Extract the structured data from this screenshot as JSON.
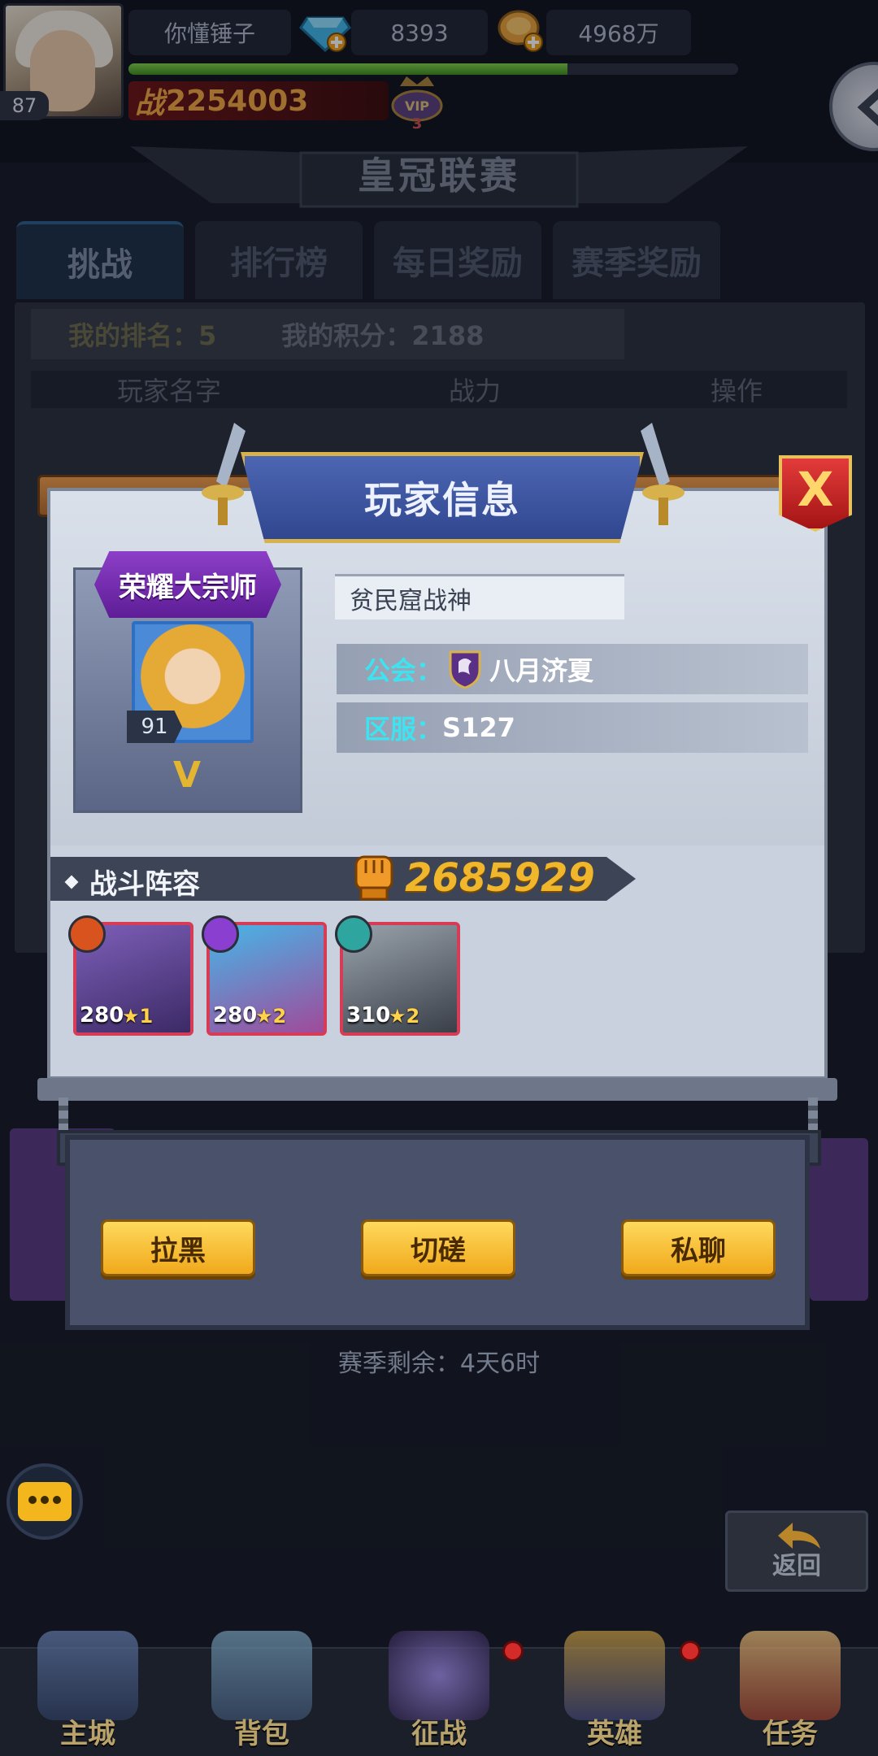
{
  "player_bar": {
    "level": "87",
    "name": "你懂锤子",
    "gems": "8393",
    "gold": "4968万",
    "exp_fraction": 0.72,
    "power_prefix": "战",
    "power": "2254003",
    "vip_level": "3",
    "vip_text": "VIP"
  },
  "page": {
    "title": "皇冠联赛"
  },
  "tabs": [
    {
      "label": "挑战",
      "active": true
    },
    {
      "label": "排行榜",
      "active": false
    },
    {
      "label": "每日奖励",
      "active": false
    },
    {
      "label": "赛季奖励",
      "active": false
    }
  ],
  "board": {
    "my_rank_label": "我的排名：5",
    "my_score_label": "我的积分：2188",
    "columns": [
      "玩家名字",
      "战力",
      "操作"
    ]
  },
  "modal": {
    "title": "玩家信息",
    "close_label": "X",
    "rank_title": "荣耀大宗师",
    "hero_level": "91",
    "hero_grade": "V",
    "player_name": "贫民窟战神",
    "guild_label": "公会：",
    "guild_name": "八月济夏",
    "server_label": "区服：",
    "server_name": "S127",
    "lineup_label": "战斗阵容",
    "lineup_power": "2685929",
    "heroes": [
      {
        "level": "280",
        "stars": "1",
        "class_color": "#d9531e"
      },
      {
        "level": "280",
        "stars": "2",
        "class_color": "#8a3fd1"
      },
      {
        "level": "310",
        "stars": "2",
        "class_color": "#2fa5a0"
      }
    ]
  },
  "actions": {
    "block": "拉黑",
    "spar": "切磋",
    "whisper": "私聊"
  },
  "season": {
    "remaining": "赛季剩余：4天6时"
  },
  "return_label": "返回",
  "nav": [
    {
      "label": "主城",
      "icon": "castle-icon",
      "badge": false
    },
    {
      "label": "背包",
      "icon": "backpack-icon",
      "badge": false
    },
    {
      "label": "征战",
      "icon": "dragon-portal-icon",
      "badge": true
    },
    {
      "label": "英雄",
      "icon": "helmet-icon",
      "badge": true
    },
    {
      "label": "任务",
      "icon": "scroll-icon",
      "badge": false
    }
  ],
  "colors": {
    "accent_gold": "#f0b62c",
    "guild_label": "#3ee3f0",
    "modal_ribbon": "#3d55a3",
    "close_red": "#c82525"
  }
}
